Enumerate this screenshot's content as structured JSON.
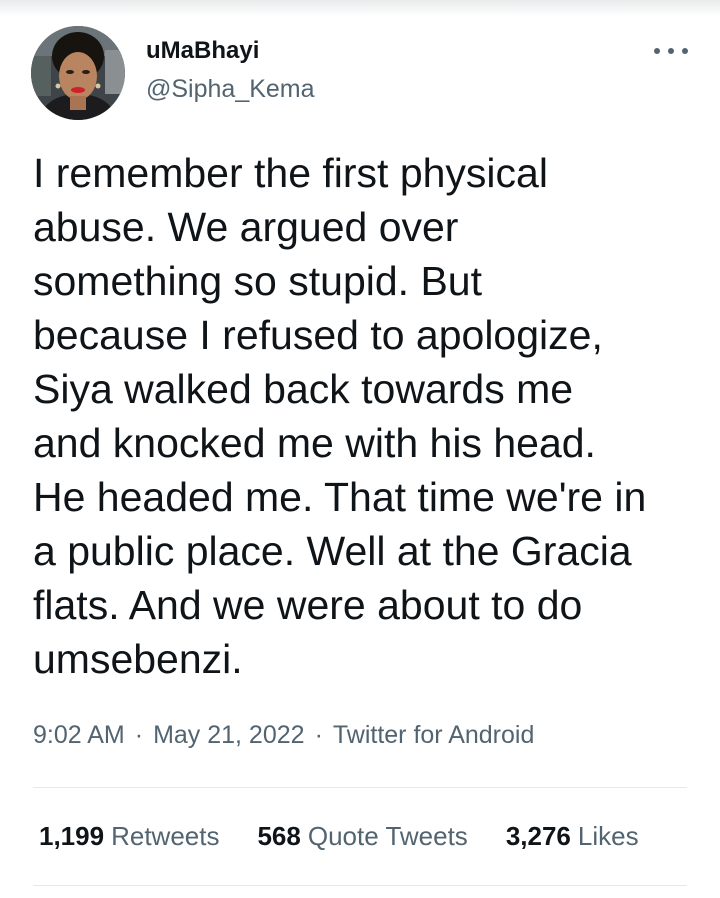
{
  "author": {
    "display_name": "uMaBhayi",
    "handle": "@Sipha_Kema",
    "avatar_icon": "profile-photo"
  },
  "more_icon": "more-horizontal-icon",
  "tweet": {
    "text_lines": [
      "I remember the first physical",
      "abuse. We argued over",
      "something so stupid. But",
      "because I refused to apologize,",
      "Siya walked back towards me",
      "and knocked me with his head.",
      "He headed me. That time we're in",
      "a public place. Well at the Gracia",
      "flats. And we were about to do",
      "umsebenzi."
    ]
  },
  "meta": {
    "time": "9:02 AM",
    "date": "May 21, 2022",
    "source": "Twitter for Android",
    "separator": "·"
  },
  "stats": {
    "retweets_count": "1,199",
    "retweets_label": "Retweets",
    "quotes_count": "568",
    "quotes_label": "Quote Tweets",
    "likes_count": "3,276",
    "likes_label": "Likes"
  },
  "colors": {
    "text_primary": "#0f1419",
    "text_secondary": "#536471",
    "divider": "#e6e9eb",
    "lipstick": "#d0202a"
  }
}
